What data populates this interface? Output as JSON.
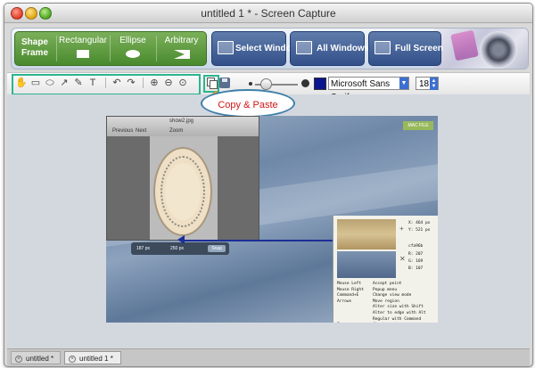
{
  "window": {
    "title": "untitled 1 * - Screen Capture"
  },
  "capture_bar": {
    "shape_frame_label": "Shape Frame",
    "rectangular_label": "Rectangular",
    "ellipse_label": "Ellipse",
    "arbitrary_label": "Arbitrary",
    "select_window_label": "Select Window",
    "all_windows_label": "All Windows",
    "full_screen_label": "Full Screen"
  },
  "toolbar": {
    "tools": [
      "hand-icon",
      "rectangle-icon",
      "ellipse-icon",
      "arrow-icon",
      "pen-icon",
      "text-icon",
      "undo-icon",
      "redo-icon",
      "zoom-in-icon",
      "zoom-out-icon",
      "zoom-reset-icon"
    ],
    "font_name": "Microsoft Sans Serif",
    "font_size": "18",
    "color": "#0b148f"
  },
  "callout": {
    "text": "Copy & Paste"
  },
  "screenshot": {
    "window_title": "show2.jpg",
    "nav_prev": "Previous",
    "nav_next": "Next",
    "zoom_label": "Zoom",
    "badge": "MAC FILE",
    "width_readout": "187 px",
    "height_readout": "250 px",
    "snap_label": "Snap",
    "coord_x": "X: 464 px",
    "coord_y": "Y: 521 px",
    "hex": "cfa96b",
    "rgb_r": "R: 207",
    "rgb_g": "G: 169",
    "rgb_b": "B: 107",
    "shortcuts_keys": "Mouse Left\nMouse Right\nCommand+E\nArrows\n\n\n\nEsc\nEnter",
    "shortcuts_desc": "Accept point\nPopup menu\nChange view mode\nMove region\nAlter size with Shift\nAlter to edge with Alt\nRegular with Command\nAbort capture\nFinish capture"
  },
  "tabs": [
    {
      "label": "untitled *"
    },
    {
      "label": "untitled 1 *"
    }
  ]
}
